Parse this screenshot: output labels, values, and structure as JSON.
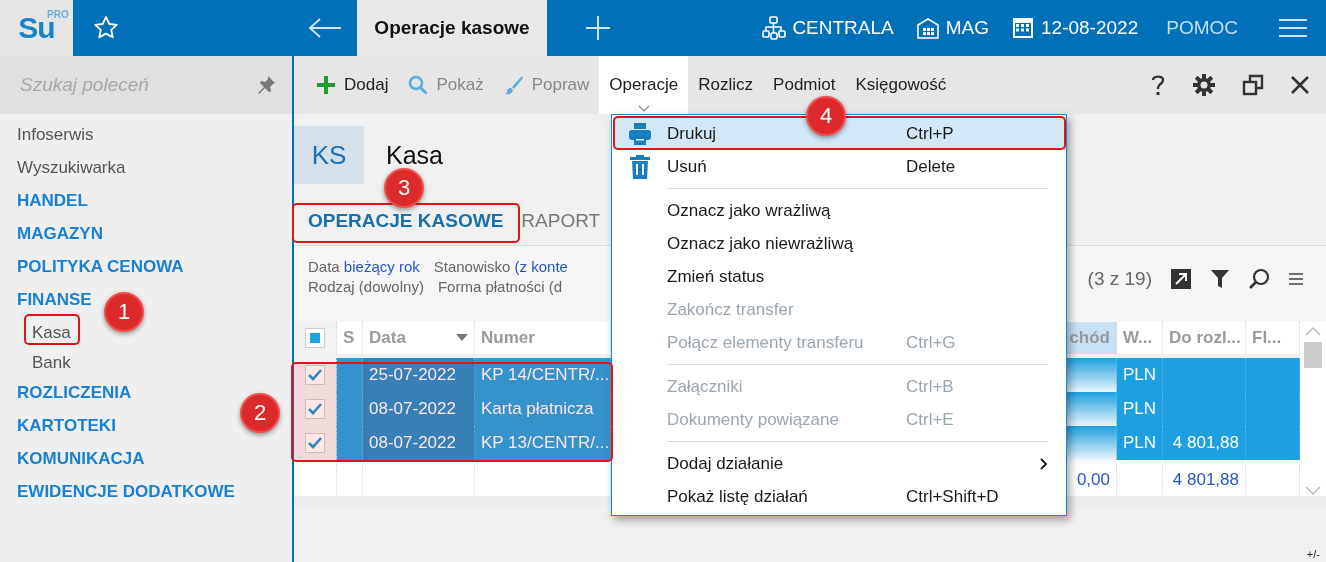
{
  "app": {
    "logo": "Su",
    "logo_badge": "PRO"
  },
  "top_bar": {
    "active_tab": "Operacje kasowe",
    "items": [
      {
        "kind": "branch",
        "label": "CENTRALA"
      },
      {
        "kind": "warehouse",
        "label": "MAG"
      },
      {
        "kind": "date",
        "label": "12-08-2022"
      },
      {
        "kind": "plain",
        "label": "POMOC"
      }
    ]
  },
  "sidebar": {
    "search": {
      "placeholder": "Szukaj poleceń"
    },
    "items": [
      {
        "kind": "link",
        "label": "Infoserwis"
      },
      {
        "kind": "link",
        "label": "Wyszukiwarka"
      },
      {
        "kind": "section",
        "label": "HANDEL"
      },
      {
        "kind": "section",
        "label": "MAGAZYN"
      },
      {
        "kind": "section",
        "label": "POLITYKA CENOWA"
      },
      {
        "kind": "section",
        "label": "FINANSE",
        "children": [
          {
            "label": "Kasa"
          },
          {
            "label": "Bank"
          }
        ]
      },
      {
        "kind": "section",
        "label": "ROZLICZENIA"
      },
      {
        "kind": "section",
        "label": "KARTOTEKI"
      },
      {
        "kind": "section",
        "label": "KOMUNIKACJA"
      },
      {
        "kind": "section",
        "label": "EWIDENCJE DODATKOWE"
      }
    ]
  },
  "toolbar": {
    "buttons": [
      {
        "kind": "add",
        "label": "Dodaj",
        "disabled": false
      },
      {
        "kind": "view",
        "label": "Pokaż",
        "disabled": true
      },
      {
        "kind": "edit",
        "label": "Popraw",
        "disabled": true
      }
    ],
    "menus": [
      {
        "label": "Operacje",
        "expanded": true
      },
      {
        "label": "Rozlicz",
        "expanded": false
      },
      {
        "label": "Podmiot",
        "expanded": false
      },
      {
        "label": "Księgowość",
        "expanded": false
      }
    ]
  },
  "header": {
    "badge": "KS",
    "title": "Kasa"
  },
  "tabs": [
    {
      "label": "OPERACJE KASOWE",
      "selected": true
    },
    {
      "label": "RAPORT",
      "selected": false
    }
  ],
  "filters": [
    [
      {
        "label": "Data",
        "value": "bieżący rok",
        "set": true
      },
      {
        "label": "Stanowisko",
        "value": "(z konte",
        "set": true
      }
    ],
    [
      {
        "label": "Rodzaj",
        "value": "(dowolny)",
        "set": false
      },
      {
        "label": "Forma płatności",
        "value": "(d",
        "set": false
      }
    ]
  ],
  "grid": {
    "count": "(3 z 19)",
    "select_all_partial": true,
    "columns": [
      {
        "label": "S",
        "sorted": false
      },
      {
        "label": "Data",
        "sorted": true
      },
      {
        "label": "Numer",
        "sorted": false
      },
      {
        "label": "chód",
        "sorted": false
      },
      {
        "label": "W...",
        "sorted": false
      },
      {
        "label": "Do rozl...",
        "sorted": false
      },
      {
        "label": "Fl...",
        "sorted": false
      }
    ],
    "rows": [
      {
        "checked": true,
        "selected": true,
        "date": "25-07-2022",
        "number": "KP 14/CENTR/...",
        "currency": "PLN"
      },
      {
        "checked": true,
        "selected": true,
        "date": "08-07-2022",
        "number": "Karta płatnicza",
        "currency": "PLN"
      },
      {
        "checked": true,
        "selected": true,
        "date": "08-07-2022",
        "number": "KP 13/CENTR/...",
        "currency": "PLN",
        "to_settle": "4 801,88"
      }
    ],
    "totals": {
      "outflow": "0,00",
      "to_settle": "4 801,88"
    }
  },
  "menu": {
    "items": [
      {
        "kind": "print",
        "label": "Drukuj",
        "shortcut": "Ctrl+P",
        "selected": true,
        "disabled": false
      },
      {
        "kind": "delete",
        "label": "Usuń",
        "shortcut": "Delete",
        "selected": false,
        "disabled": false
      },
      {
        "kind": "separator"
      },
      {
        "kind": "item",
        "label": "Oznacz jako wrażliwą",
        "selected": false,
        "disabled": false
      },
      {
        "kind": "item",
        "label": "Oznacz jako niewrażliwą",
        "selected": false,
        "disabled": false
      },
      {
        "kind": "item",
        "label": "Zmień status",
        "selected": false,
        "disabled": false
      },
      {
        "kind": "item",
        "label": "Zakończ transfer",
        "selected": false,
        "disabled": true
      },
      {
        "kind": "item",
        "label": "Połącz elementy transferu",
        "shortcut": "Ctrl+G",
        "selected": false,
        "disabled": true
      },
      {
        "kind": "separator"
      },
      {
        "kind": "item",
        "label": "Załączniki",
        "shortcut": "Ctrl+B",
        "selected": false,
        "disabled": true
      },
      {
        "kind": "item",
        "label": "Dokumenty powiązane",
        "shortcut": "Ctrl+E",
        "selected": false,
        "disabled": true
      },
      {
        "kind": "separator"
      },
      {
        "kind": "submenu",
        "label": "Dodaj działanie",
        "selected": false,
        "disabled": false
      },
      {
        "kind": "item",
        "label": "Pokaż listę działań",
        "shortcut": "Ctrl+Shift+D",
        "selected": false,
        "disabled": false
      }
    ]
  },
  "footer": {
    "label": "+/-"
  },
  "annotations": [
    {
      "label": "1"
    },
    {
      "label": "2"
    },
    {
      "label": "3"
    },
    {
      "label": "4"
    }
  ]
}
